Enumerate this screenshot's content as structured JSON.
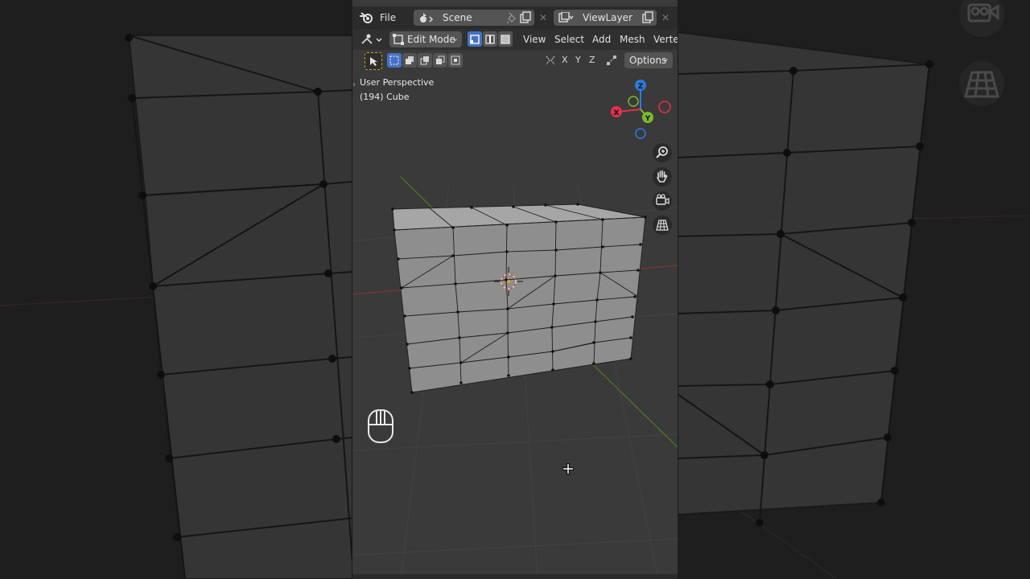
{
  "header": {
    "menu_file": "File",
    "scene_label": "Scene",
    "view_layer_label": "ViewLayer"
  },
  "toolbar": {
    "mode_label": "Edit Mode",
    "menus": [
      "View",
      "Select",
      "Add",
      "Mesh",
      "Vertex"
    ],
    "axes": [
      "X",
      "Y",
      "Z"
    ],
    "options_label": "Options"
  },
  "viewport": {
    "perspective_label": "User Perspective",
    "object_label": "(194) Cube"
  },
  "gizmo": {
    "x_label": "X",
    "y_label": "Y",
    "z_label": "Z",
    "x_color": "#e2314a",
    "y_color": "#7dba2d",
    "z_color": "#2c7ae0"
  },
  "colors": {
    "header_bg": "#2b2b2b",
    "viewport_bg": "#3a3a3a",
    "accent": "#4672c4",
    "mesh_face": "#8e8e8e"
  }
}
